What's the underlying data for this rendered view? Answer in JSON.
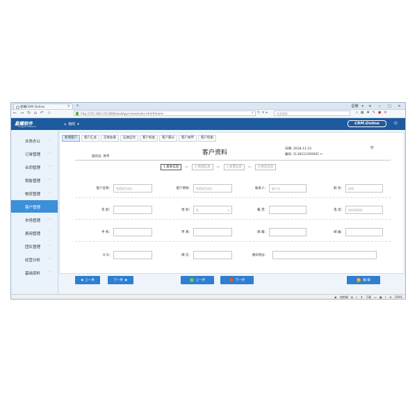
{
  "browser": {
    "tab_title": "星耀CRM Online",
    "tab_close": "×",
    "new_tab": "+",
    "user_label": "星耀",
    "url": "http://192.168.0.50:8080/webApp/views/index.html#/home",
    "search_placeholder": "在此搜索",
    "status_items": [
      "快剪辑",
      "下载",
      "100%"
    ]
  },
  "app": {
    "logo_text": "星耀软件",
    "logo_sub": "Xingyao software",
    "home_label": "我的",
    "brand": "CRM.Online"
  },
  "sidebar": {
    "items": [
      {
        "label": "业务办公"
      },
      {
        "label": "订单管理"
      },
      {
        "label": "合同管理"
      },
      {
        "label": "销售管理"
      },
      {
        "label": "物流管理"
      },
      {
        "label": "客户管理",
        "active": true
      },
      {
        "label": "市场管理"
      },
      {
        "label": "费用管理"
      },
      {
        "label": "团队管理"
      },
      {
        "label": "经营分析"
      },
      {
        "label": "基础资料"
      }
    ]
  },
  "content_tabs": [
    "新增客户",
    "客户汇总",
    "交易往来",
    "应收应付",
    "客户机会",
    "客户漏斗",
    "客户关怀",
    "客户检索"
  ],
  "form": {
    "title": "客户资料",
    "operator": "操作员: 周平",
    "date": "日期: 2018-11-23",
    "code": "编号: CL18112300001",
    "steps": [
      "1.基本信息",
      "2.管理信息",
      "3.发票信息",
      "4.物流信息"
    ],
    "rows": [
      [
        {
          "label": "客户名称：",
          "placeholder": "免费填写地址"
        },
        {
          "label": "客户简称：",
          "placeholder": "免费填写地址"
        },
        {
          "label": "联系人：",
          "placeholder": "客户名"
        },
        {
          "label": "职 务：",
          "placeholder": "经理"
        }
      ],
      [
        {
          "label": "年 龄：",
          "placeholder": ""
        },
        {
          "label": "性 别：",
          "placeholder": "男"
        },
        {
          "label": "籍 贯：",
          "placeholder": ""
        },
        {
          "label": "电 话：",
          "placeholder": "88588888"
        }
      ],
      [
        {
          "label": "手 机：",
          "placeholder": ""
        },
        {
          "label": "传 真：",
          "placeholder": ""
        },
        {
          "label": "邮 箱：",
          "placeholder": ""
        },
        {
          "label": "邮 编：",
          "placeholder": ""
        }
      ],
      [
        {
          "label": "Q Q：",
          "placeholder": ""
        },
        {
          "label": "微 信：",
          "placeholder": ""
        },
        {
          "label": "通讯地址：",
          "placeholder": ""
        }
      ]
    ]
  },
  "buttons": {
    "prev_record": "上一条",
    "next_record": "下一条",
    "prev_step": "上一步",
    "next_step": "下一步",
    "edit": "编 辑"
  }
}
